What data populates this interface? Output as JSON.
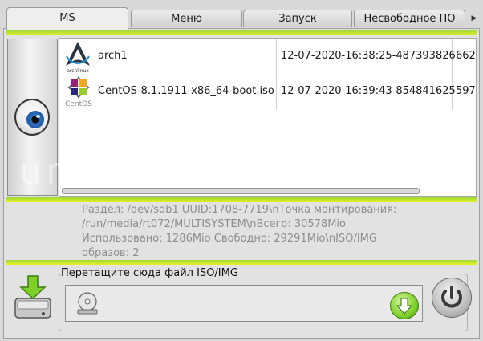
{
  "tabs": [
    {
      "label": "MS",
      "active": true
    },
    {
      "label": "Меню",
      "active": false
    },
    {
      "label": "Запуск",
      "active": false
    },
    {
      "label": "Несвободное ПО",
      "active": false
    }
  ],
  "iso_list": [
    {
      "name": "arch1",
      "date": "12-07-2020-16:38:25-487393826",
      "extra": "662",
      "icon": "archlinux-logo-icon"
    },
    {
      "name": "CentOS-8.1.1911-x86_64-boot.iso",
      "date": "12-07-2020-16:39:43-854841625",
      "extra": "597",
      "icon": "centos-logo-icon"
    }
  ],
  "logos": {
    "arch": "archlinux",
    "centos": "CentOS"
  },
  "info_text": "Раздел: /dev/sdb1 UUID:1708-7719\\nТочка монтирования: /run/media/rt072/MULTISYSTEM\\nВсего: 30578Mio Использовано: 1286Mio Свободно: 29291Mio\\nISO/IMG образов: 2",
  "drop": {
    "label": "Перетащите сюда файл ISO/IMG"
  },
  "watermark": "unixawesome.com",
  "colors": {
    "stripe_green": "#9cd83a",
    "stripe_yellow": "#e8f020",
    "accent_blue": "#2d74c8",
    "go_green": "#7ed02a"
  }
}
